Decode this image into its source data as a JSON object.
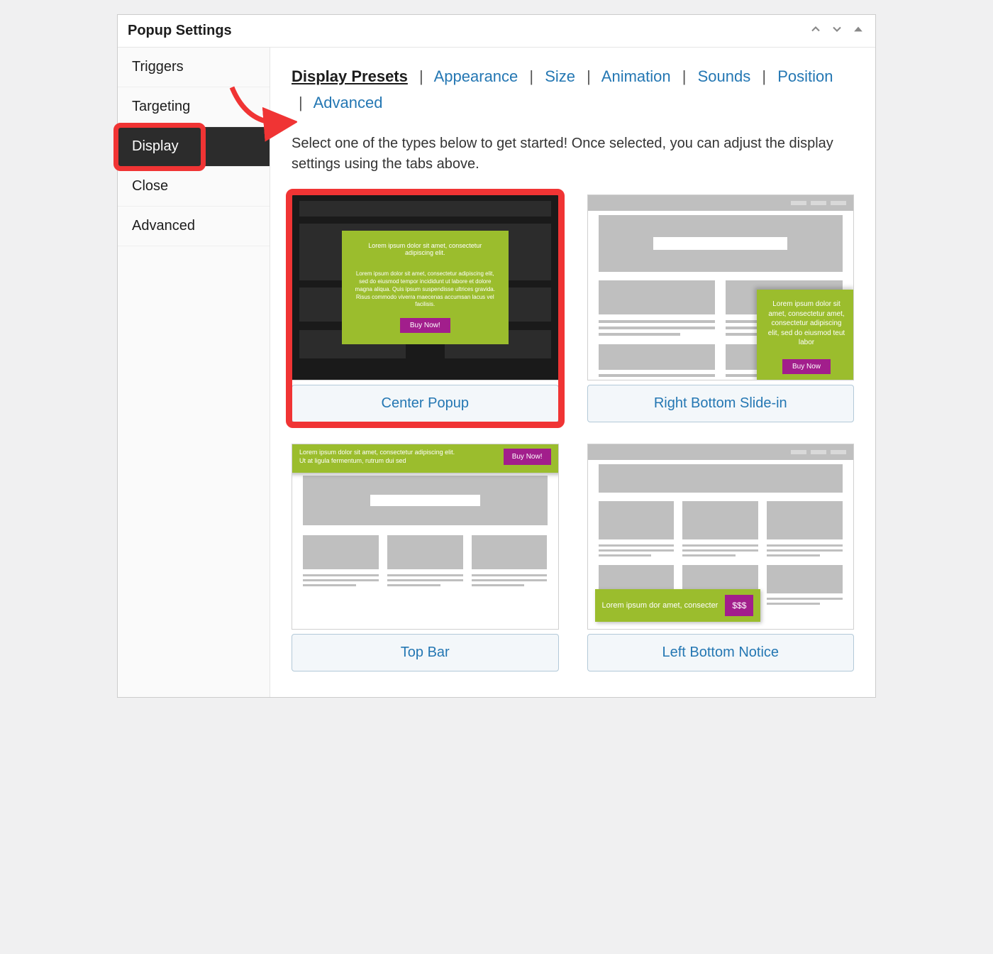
{
  "panel": {
    "title": "Popup Settings"
  },
  "sidebar": {
    "items": [
      {
        "label": "Triggers"
      },
      {
        "label": "Targeting"
      },
      {
        "label": "Display"
      },
      {
        "label": "Close"
      },
      {
        "label": "Advanced"
      }
    ]
  },
  "tabs": {
    "display_presets": "Display Presets",
    "appearance": "Appearance",
    "size": "Size",
    "animation": "Animation",
    "sounds": "Sounds",
    "position": "Position",
    "advanced": "Advanced"
  },
  "description": "Select one of the types below to get started! Once selected, you can adjust the display settings using the tabs above.",
  "presets": {
    "center_popup": {
      "label": "Center Popup",
      "heading": "Lorem ipsum dolor sit amet, consectetur adipiscing elit.",
      "body": "Lorem ipsum dolor sit amet, consectetur adipiscing elit, sed do eiusmod tempor incididunt ut labore et dolore magna aliqua. Quis ipsum suspendisse ultrices gravida. Risus commodo viverra maecenas accumsan lacus vel facilisis.",
      "button": "Buy Now!"
    },
    "right_bottom_slidein": {
      "label": "Right Bottom Slide-in",
      "body": "Lorem ipsum dolor sit amet, consectetur amet, consectetur adipiscing elit, sed do eiusmod teut labor",
      "button": "Buy Now"
    },
    "top_bar": {
      "label": "Top Bar",
      "line1": "Lorem ipsum dolor sit amet, consectetur adipiscing elit.",
      "line2": "Ut at ligula fermentum, rutrum dui sed",
      "button": "Buy Now!"
    },
    "left_bottom_notice": {
      "label": "Left Bottom Notice",
      "body": "Lorem ipsum dor amet, consecter",
      "icon_label": "$$$"
    }
  }
}
